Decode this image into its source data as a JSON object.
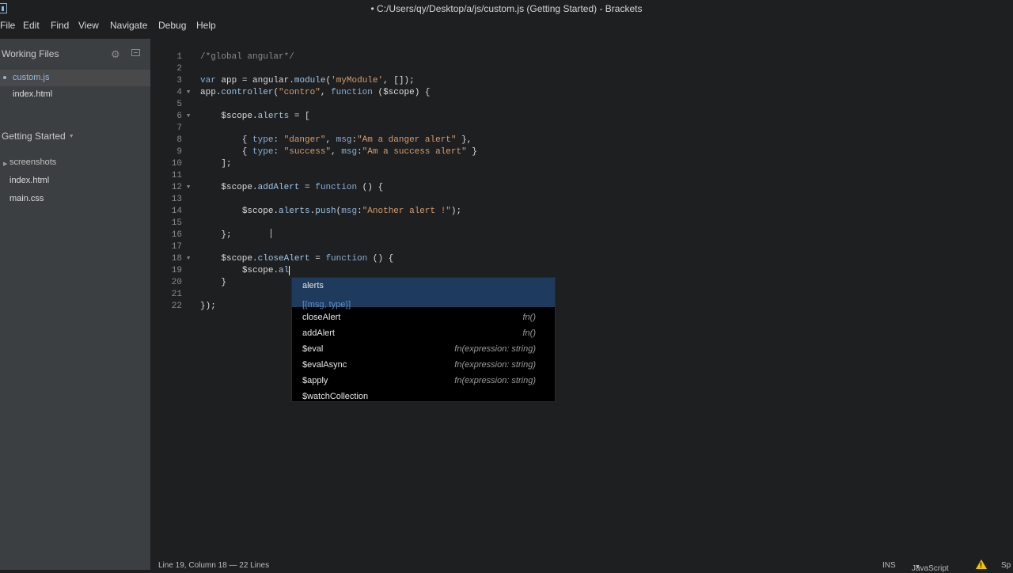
{
  "window": {
    "title": "• C:/Users/qy/Desktop/a/js/custom.js (Getting Started) - Brackets"
  },
  "menu": [
    "File",
    "Edit",
    "Find",
    "View",
    "Navigate",
    "Debug",
    "Help"
  ],
  "sidebar": {
    "working_files_label": "Working Files",
    "working_files": [
      "custom.js",
      "index.html"
    ],
    "project_label": "Getting Started",
    "project_items": [
      {
        "label": "screenshots",
        "folder": true
      },
      {
        "label": "index.html",
        "folder": false
      },
      {
        "label": "main.css",
        "folder": false
      }
    ]
  },
  "editor": {
    "lines": [
      "/*global angular*/",
      "",
      "var app = angular.module('myModule', []);",
      "app.controller(\"contro\", function ($scope) {",
      "",
      "    $scope.alerts = [",
      "",
      "        { type: \"danger\", msg:\"Am a danger alert\" },",
      "        { type: \"success\", msg:\"Am a success alert\" }",
      "    ];",
      "",
      "    $scope.addAlert = function () {",
      "",
      "        $scope.alerts.push(msg:\"Another alert !\");",
      "",
      "    };",
      "",
      "    $scope.closeAlert = function () {",
      "        $scope.al",
      "    }",
      "",
      "});"
    ],
    "fold_lines": [
      4,
      6,
      12,
      18
    ]
  },
  "hints": {
    "selected": {
      "name": "alerts",
      "detail": "[{msg, type}]"
    },
    "items": [
      {
        "name": "closeAlert",
        "type": "fn()"
      },
      {
        "name": "addAlert",
        "type": "fn()"
      },
      {
        "name": "$eval",
        "type": "fn(expression: string)"
      },
      {
        "name": "$evalAsync",
        "type": "fn(expression: string)"
      },
      {
        "name": "$apply",
        "type": "fn(expression: string)"
      },
      {
        "name": "$watchCollection",
        "type": ""
      }
    ]
  },
  "status": {
    "position": "Line 19, Column 18 — 22 Lines",
    "mode": "INS",
    "language": "JavaScript",
    "extra": "Sp"
  },
  "icons": [
    "brackets-app-icon",
    "gear-icon",
    "split-view-icon",
    "warning-icon"
  ],
  "colors": {
    "accent": "#1e3a5c",
    "warning": "#f2c500",
    "sidebar": "#3c3f41"
  }
}
